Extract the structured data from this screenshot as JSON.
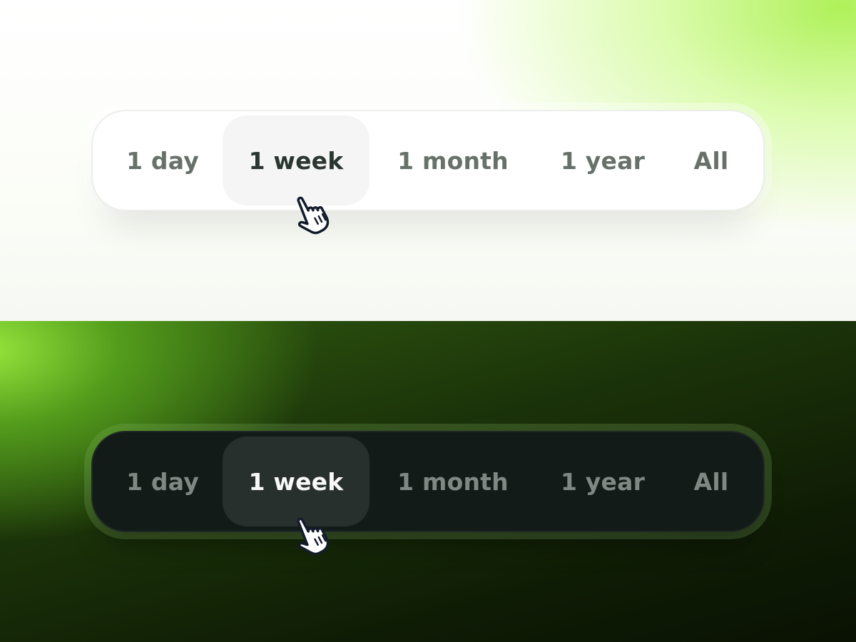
{
  "light": {
    "segments": [
      {
        "label": "1 day",
        "active": false
      },
      {
        "label": "1 week",
        "active": true
      },
      {
        "label": "1 month",
        "active": false
      },
      {
        "label": "1 year",
        "active": false
      },
      {
        "label": "All",
        "active": false
      }
    ],
    "cursor_icon": "hand-pointer-icon",
    "colors": {
      "accent": "#b4f06a",
      "background": "#ffffff",
      "active_bg": "#f4f5f4",
      "text": "#687169",
      "active_text": "#2c3630"
    }
  },
  "dark": {
    "segments": [
      {
        "label": "1 day",
        "active": false
      },
      {
        "label": "1 week",
        "active": true
      },
      {
        "label": "1 month",
        "active": false
      },
      {
        "label": "1 year",
        "active": false
      },
      {
        "label": "All",
        "active": false
      }
    ],
    "cursor_icon": "hand-pointer-icon",
    "colors": {
      "accent": "#7ad43a",
      "background": "#131b18",
      "active_bg": "#27302c",
      "text": "#7f8983",
      "active_text": "#f7f8f7"
    }
  }
}
